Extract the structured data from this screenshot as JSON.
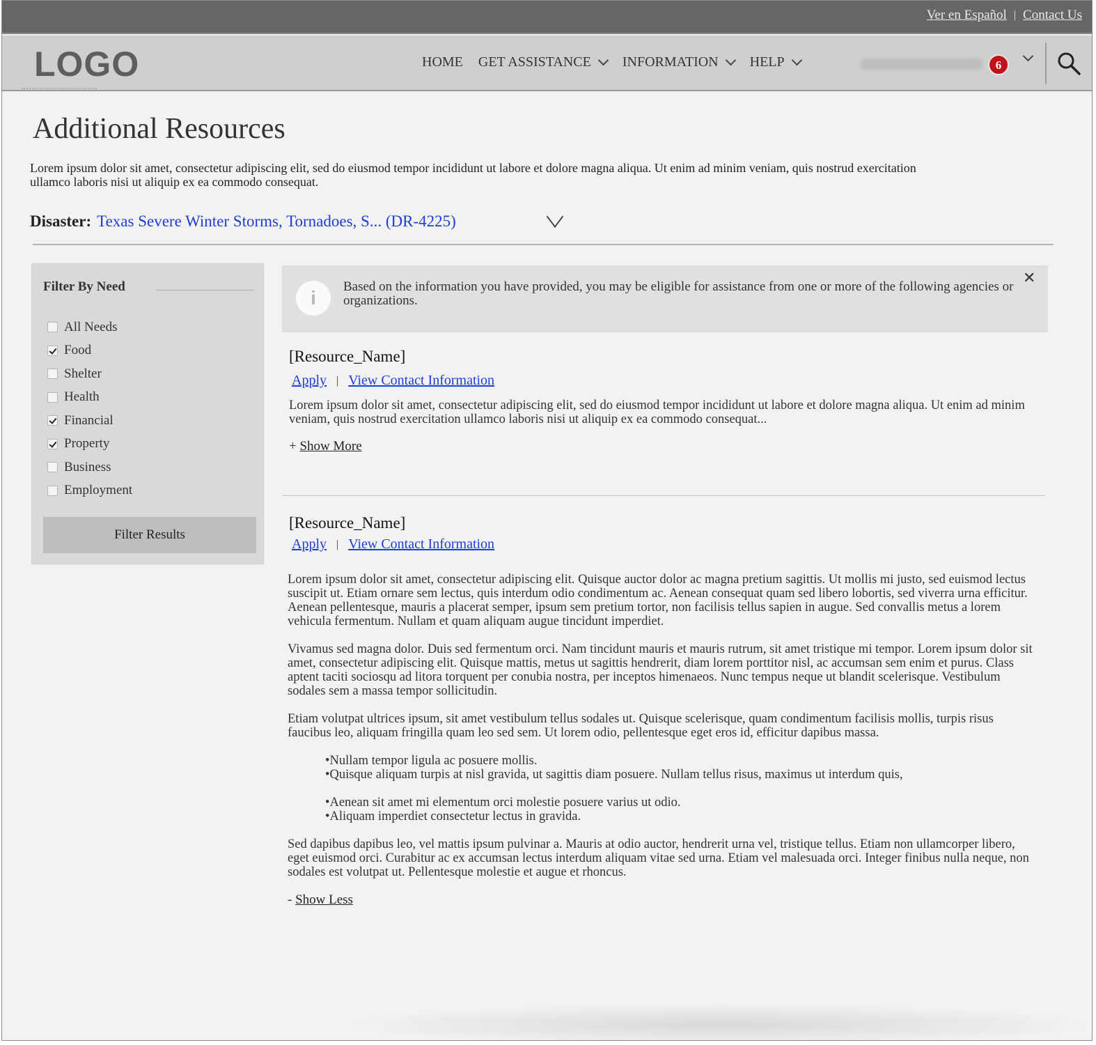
{
  "utility": {
    "spanish_label": "Ver en Español",
    "separator": "|",
    "contact_label": "Contact Us"
  },
  "header": {
    "logo": "LOGO",
    "nav": [
      {
        "label": "HOME",
        "has_dropdown": false
      },
      {
        "label": "GET ASSISTANCE",
        "has_dropdown": true
      },
      {
        "label": "INFORMATION",
        "has_dropdown": true
      },
      {
        "label": "HELP",
        "has_dropdown": true
      }
    ],
    "notification_count": "6",
    "badge_color": "#c0121a",
    "search_icon": "search-icon"
  },
  "page": {
    "title": "Additional Resources",
    "intro": "Lorem ipsum dolor sit amet, consectetur adipiscing elit, sed do eiusmod tempor incididunt ut labore et dolore magna aliqua. Ut enim ad minim veniam, quis nostrud exercitation ullamco laboris nisi ut aliquip ex ea commodo consequat.",
    "disaster_label": "Disaster:",
    "disaster_value": "Texas Severe Winter Storms, Tornadoes, S... (DR-4225)",
    "link_color": "#1f3cd6"
  },
  "filter": {
    "title": "Filter By Need",
    "items": [
      {
        "label": "All Needs",
        "checked": false
      },
      {
        "label": "Food",
        "checked": true
      },
      {
        "label": "Shelter",
        "checked": false
      },
      {
        "label": "Health",
        "checked": false
      },
      {
        "label": "Financial",
        "checked": true
      },
      {
        "label": "Property",
        "checked": true
      },
      {
        "label": "Business",
        "checked": false
      },
      {
        "label": "Employment",
        "checked": false
      }
    ],
    "button_label": "Filter Results"
  },
  "banner": {
    "icon": "info-icon",
    "icon_glyph": "i",
    "text": "Based on the information you have provided, you may be eligible for assistance from one or more of the following agencies or organizations.",
    "close_glyph": "✕"
  },
  "resources": [
    {
      "name": "[Resource_Name]",
      "apply_label": "Apply",
      "separator": "|",
      "contact_label": "View Contact Information",
      "description": "Lorem ipsum dolor sit amet, consectetur adipiscing elit, sed do eiusmod tempor incididunt ut labore et dolore magna aliqua. Ut enim ad minim veniam, quis nostrud exercitation ullamco laboris nisi ut aliquip ex ea commodo consequat...",
      "toggle_prefix": "+",
      "toggle_label": "Show More"
    },
    {
      "name": "[Resource_Name]",
      "apply_label": "Apply",
      "separator": "|",
      "contact_label": "View Contact Information",
      "paragraphs": [
        "Lorem ipsum dolor sit amet, consectetur adipiscing elit. Quisque auctor dolor ac magna pretium sagittis. Ut mollis mi justo, sed euismod lectus suscipit ut. Etiam ornare sem lectus, quis interdum odio condimentum ac. Aenean consequat quam sed libero lobortis, sed viverra urna efficitur. Aenean pellentesque, mauris a placerat semper, ipsum sem pretium tortor, non facilisis tellus sapien in augue. Sed convallis metus a lorem vehicula fermentum. Nullam et quam aliquam augue tincidunt imperdiet.",
        "Vivamus sed magna dolor. Duis sed fermentum orci. Nam tincidunt mauris et mauris rutrum, sit amet tristique mi tempor. Lorem ipsum dolor sit amet, consectetur adipiscing elit. Quisque mattis, metus ut sagittis hendrerit, diam lorem porttitor nisl, ac accumsan sem enim et purus. Class aptent taciti sociosqu ad litora torquent per conubia nostra, per inceptos himenaeos. Nunc tempus neque ut blandit scelerisque. Vestibulum sodales sem a massa tempor sollicitudin.",
        "Etiam volutpat ultrices ipsum, sit amet vestibulum tellus sodales ut. Quisque scelerisque, quam condimentum facilisis mollis, turpis risus faucibus leo, aliquam fringilla quam leo sed sem. Ut lorem odio, pellentesque eget eros id, efficitur dapibus massa."
      ],
      "bullets_a": [
        "Nullam tempor ligula ac posuere mollis.",
        "Quisque aliquam turpis at nisl gravida, ut sagittis diam posuere. Nullam tellus risus, maximus ut interdum quis,"
      ],
      "bullets_b": [
        "Aenean sit amet mi elementum orci molestie posuere varius ut odio.",
        "Aliquam imperdiet consectetur lectus in gravida."
      ],
      "closing": "Sed dapibus dapibus leo, vel mattis ipsum pulvinar a. Mauris at odio auctor, hendrerit urna vel, tristique tellus. Etiam non ullamcorper libero, eget euismod orci. Curabitur ac ex accumsan lectus interdum aliquam vitae sed urna. Etiam vel malesuada orci. Integer finibus nulla neque, non sodales est volutpat ut. Pellentesque molestie et augue et rhoncus.",
      "toggle_prefix": "-",
      "toggle_label": "Show Less"
    }
  ]
}
